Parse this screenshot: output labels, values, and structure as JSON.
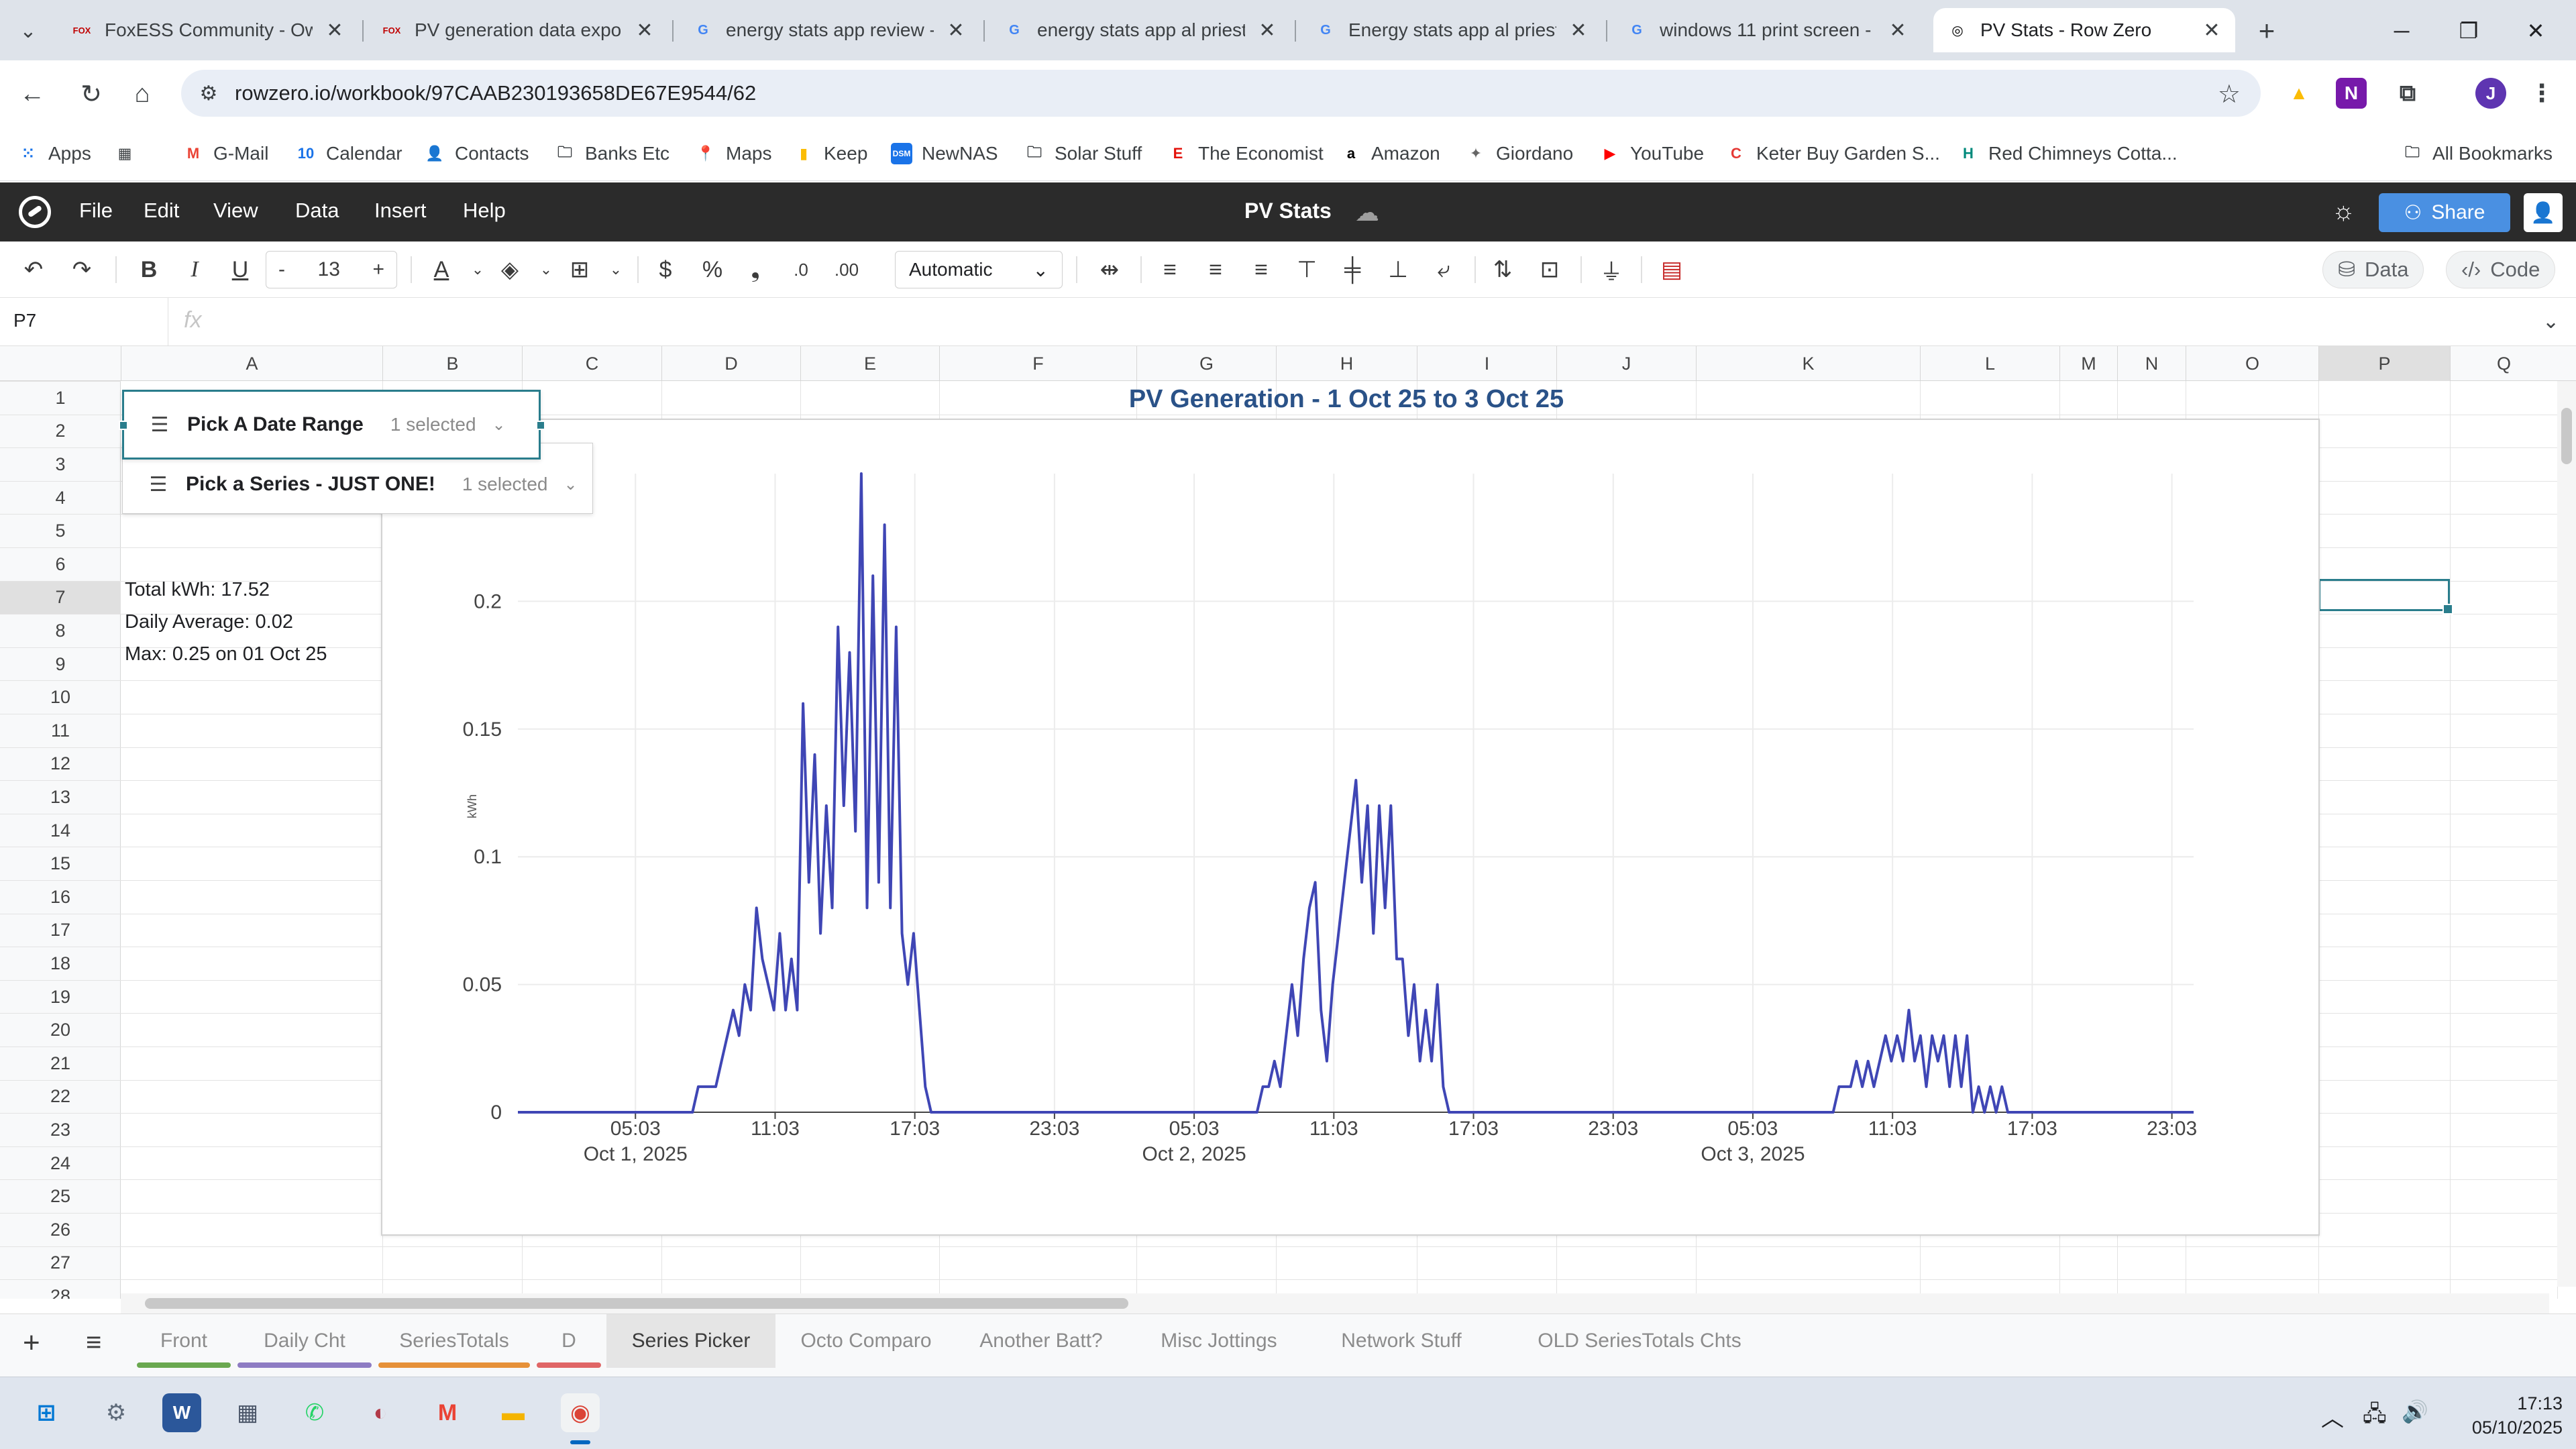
{
  "browser": {
    "tabs": [
      {
        "favicon": "FOX",
        "favicon_color": "#c00000",
        "title": "FoxESS Community - Ow",
        "active": false
      },
      {
        "favicon": "FOX",
        "favicon_color": "#c00000",
        "title": "PV generation data expor",
        "active": false
      },
      {
        "favicon": "G",
        "favicon_color": "#4285f4",
        "title": "energy stats app review -",
        "active": false
      },
      {
        "favicon": "G",
        "favicon_color": "#4285f4",
        "title": "energy stats app al priest",
        "active": false
      },
      {
        "favicon": "G",
        "favicon_color": "#4285f4",
        "title": "Energy stats app al priest",
        "active": false
      },
      {
        "favicon": "G",
        "favicon_color": "#4285f4",
        "title": "windows 11 print screen -",
        "active": false
      },
      {
        "favicon": "◎",
        "favicon_color": "#000000",
        "title": "PV Stats - Row Zero",
        "active": true
      }
    ],
    "url": "rowzero.io/workbook/97CAAB230193658DE67E9544/62",
    "bookmarks": [
      {
        "label": "Apps",
        "icon": "apps-grid-icon",
        "glyph": "⁙",
        "color": "#1a73e8"
      },
      {
        "label": "",
        "icon": "tab-groups-icon",
        "glyph": "▦",
        "color": "#3c4043"
      },
      {
        "label": "G-Mail",
        "icon": "gmail-icon",
        "glyph": "M",
        "color": "#ea4335"
      },
      {
        "label": "Calendar",
        "icon": "calendar-icon",
        "glyph": "10",
        "color": "#1a73e8"
      },
      {
        "label": "Contacts",
        "icon": "contacts-icon",
        "glyph": "👤",
        "color": "#1a73e8"
      },
      {
        "label": "Banks Etc",
        "icon": "folder-icon",
        "glyph": "🗀",
        "color": "#3c4043"
      },
      {
        "label": "Maps",
        "icon": "maps-icon",
        "glyph": "📍",
        "color": "#34a853"
      },
      {
        "label": "Keep",
        "icon": "keep-icon",
        "glyph": "▮",
        "color": "#fbbc04"
      },
      {
        "label": "NewNAS",
        "icon": "nas-icon",
        "glyph": "DSM",
        "color": "#1a73e8"
      },
      {
        "label": "Solar Stuff",
        "icon": "folder-icon",
        "glyph": "🗀",
        "color": "#3c4043"
      },
      {
        "label": "The Economist",
        "icon": "economist-icon",
        "glyph": "E",
        "color": "#e3120b"
      },
      {
        "label": "Amazon",
        "icon": "amazon-icon",
        "glyph": "a",
        "color": "#000000"
      },
      {
        "label": "Giordano",
        "icon": "giordano-icon",
        "glyph": "✦",
        "color": "#666666"
      },
      {
        "label": "YouTube",
        "icon": "youtube-icon",
        "glyph": "▶",
        "color": "#ff0000"
      },
      {
        "label": "Keter Buy Garden S...",
        "icon": "keter-icon",
        "glyph": "C",
        "color": "#e53935"
      },
      {
        "label": "Red Chimneys Cotta...",
        "icon": "red-chimneys-icon",
        "glyph": "H",
        "color": "#00897b"
      }
    ],
    "all_bookmarks": "All Bookmarks"
  },
  "app": {
    "menus": [
      "File",
      "Edit",
      "View",
      "Data",
      "Insert",
      "Help"
    ],
    "title": "PV Stats",
    "share_label": "Share",
    "font_size": "13",
    "number_format": "Automatic",
    "data_label": "Data",
    "code_label": "Code",
    "cell_ref": "P7",
    "fx": "fx"
  },
  "grid": {
    "columns": [
      "A",
      "B",
      "C",
      "D",
      "E",
      "F",
      "G",
      "H",
      "I",
      "J",
      "K",
      "L",
      "M",
      "N",
      "O",
      "P",
      "Q"
    ],
    "rows": [
      "1",
      "2",
      "3",
      "4",
      "5",
      "6",
      "7",
      "8",
      "9",
      "10",
      "11",
      "12",
      "13",
      "14",
      "15",
      "16",
      "17",
      "18",
      "19",
      "20",
      "21",
      "22",
      "23",
      "24",
      "25",
      "26",
      "27",
      "28"
    ],
    "selected_column": "P",
    "selected_row": "7",
    "cells": {
      "a7": "Total kWh: 17.52",
      "a8": "Daily Average: 0.02",
      "a9": "Max: 0.25 on 01 Oct 25"
    }
  },
  "slicers": {
    "date": {
      "title": "Pick A Date Range",
      "count": "1 selected"
    },
    "series": {
      "title": "Pick a Series - JUST ONE!",
      "count": "1 selected"
    }
  },
  "chart_data": {
    "type": "line",
    "title": "PV Generation - 1 Oct 25 to 3 Oct 25",
    "ylabel": "kWh",
    "xlabel": "",
    "ylim": [
      0,
      0.25
    ],
    "yticks": [
      "0",
      "0.05",
      "0.1",
      "0.15",
      "0.2"
    ],
    "xticks": [
      {
        "time": "05:03",
        "date": "Oct 1, 2025"
      },
      {
        "time": "11:03",
        "date": ""
      },
      {
        "time": "17:03",
        "date": ""
      },
      {
        "time": "23:03",
        "date": ""
      },
      {
        "time": "05:03",
        "date": "Oct 2, 2025"
      },
      {
        "time": "11:03",
        "date": ""
      },
      {
        "time": "17:03",
        "date": ""
      },
      {
        "time": "23:03",
        "date": ""
      },
      {
        "time": "05:03",
        "date": "Oct 3, 2025"
      },
      {
        "time": "11:03",
        "date": ""
      },
      {
        "time": "17:03",
        "date": ""
      },
      {
        "time": "23:03",
        "date": ""
      }
    ],
    "grid": true,
    "legend": "none",
    "line_color": "#3f46b5",
    "series": [
      {
        "points": [
          [
            "2025-10-01 00:00",
            0
          ],
          [
            "2025-10-01 07:30",
            0
          ],
          [
            "2025-10-01 07:45",
            0.01
          ],
          [
            "2025-10-01 08:30",
            0.01
          ],
          [
            "2025-10-01 08:45",
            0.02
          ],
          [
            "2025-10-01 09:00",
            0.03
          ],
          [
            "2025-10-01 09:15",
            0.04
          ],
          [
            "2025-10-01 09:30",
            0.03
          ],
          [
            "2025-10-01 09:45",
            0.05
          ],
          [
            "2025-10-01 10:00",
            0.04
          ],
          [
            "2025-10-01 10:15",
            0.08
          ],
          [
            "2025-10-01 10:30",
            0.06
          ],
          [
            "2025-10-01 10:45",
            0.05
          ],
          [
            "2025-10-01 11:00",
            0.04
          ],
          [
            "2025-10-01 11:15",
            0.07
          ],
          [
            "2025-10-01 11:30",
            0.04
          ],
          [
            "2025-10-01 11:45",
            0.06
          ],
          [
            "2025-10-01 12:00",
            0.04
          ],
          [
            "2025-10-01 12:15",
            0.16
          ],
          [
            "2025-10-01 12:30",
            0.09
          ],
          [
            "2025-10-01 12:45",
            0.14
          ],
          [
            "2025-10-01 13:00",
            0.07
          ],
          [
            "2025-10-01 13:15",
            0.12
          ],
          [
            "2025-10-01 13:30",
            0.08
          ],
          [
            "2025-10-01 13:45",
            0.19
          ],
          [
            "2025-10-01 14:00",
            0.12
          ],
          [
            "2025-10-01 14:15",
            0.18
          ],
          [
            "2025-10-01 14:30",
            0.11
          ],
          [
            "2025-10-01 14:45",
            0.25
          ],
          [
            "2025-10-01 15:00",
            0.08
          ],
          [
            "2025-10-01 15:15",
            0.21
          ],
          [
            "2025-10-01 15:30",
            0.09
          ],
          [
            "2025-10-01 15:45",
            0.23
          ],
          [
            "2025-10-01 16:00",
            0.08
          ],
          [
            "2025-10-01 16:15",
            0.19
          ],
          [
            "2025-10-01 16:30",
            0.07
          ],
          [
            "2025-10-01 16:45",
            0.05
          ],
          [
            "2025-10-01 17:00",
            0.07
          ],
          [
            "2025-10-01 17:15",
            0.04
          ],
          [
            "2025-10-01 17:30",
            0.01
          ],
          [
            "2025-10-01 17:45",
            0
          ],
          [
            "2025-10-02 07:45",
            0
          ],
          [
            "2025-10-02 08:00",
            0.01
          ],
          [
            "2025-10-02 08:15",
            0.01
          ],
          [
            "2025-10-02 08:30",
            0.02
          ],
          [
            "2025-10-02 08:45",
            0.01
          ],
          [
            "2025-10-02 09:00",
            0.03
          ],
          [
            "2025-10-02 09:15",
            0.05
          ],
          [
            "2025-10-02 09:30",
            0.03
          ],
          [
            "2025-10-02 09:45",
            0.06
          ],
          [
            "2025-10-02 10:00",
            0.08
          ],
          [
            "2025-10-02 10:15",
            0.09
          ],
          [
            "2025-10-02 10:30",
            0.04
          ],
          [
            "2025-10-02 10:45",
            0.02
          ],
          [
            "2025-10-02 11:00",
            0.05
          ],
          [
            "2025-10-02 11:15",
            0.07
          ],
          [
            "2025-10-02 11:30",
            0.09
          ],
          [
            "2025-10-02 11:45",
            0.11
          ],
          [
            "2025-10-02 12:00",
            0.13
          ],
          [
            "2025-10-02 12:15",
            0.09
          ],
          [
            "2025-10-02 12:30",
            0.12
          ],
          [
            "2025-10-02 12:45",
            0.07
          ],
          [
            "2025-10-02 13:00",
            0.12
          ],
          [
            "2025-10-02 13:15",
            0.08
          ],
          [
            "2025-10-02 13:30",
            0.12
          ],
          [
            "2025-10-02 13:45",
            0.06
          ],
          [
            "2025-10-02 14:00",
            0.06
          ],
          [
            "2025-10-02 14:15",
            0.03
          ],
          [
            "2025-10-02 14:30",
            0.05
          ],
          [
            "2025-10-02 14:45",
            0.02
          ],
          [
            "2025-10-02 15:00",
            0.04
          ],
          [
            "2025-10-02 15:15",
            0.02
          ],
          [
            "2025-10-02 15:30",
            0.05
          ],
          [
            "2025-10-02 15:45",
            0.01
          ],
          [
            "2025-10-02 16:00",
            0
          ],
          [
            "2025-10-03 08:30",
            0
          ],
          [
            "2025-10-03 08:45",
            0.01
          ],
          [
            "2025-10-03 09:15",
            0.01
          ],
          [
            "2025-10-03 09:30",
            0.02
          ],
          [
            "2025-10-03 09:45",
            0.01
          ],
          [
            "2025-10-03 10:00",
            0.02
          ],
          [
            "2025-10-03 10:15",
            0.01
          ],
          [
            "2025-10-03 10:30",
            0.02
          ],
          [
            "2025-10-03 10:45",
            0.03
          ],
          [
            "2025-10-03 11:00",
            0.02
          ],
          [
            "2025-10-03 11:15",
            0.03
          ],
          [
            "2025-10-03 11:30",
            0.02
          ],
          [
            "2025-10-03 11:45",
            0.04
          ],
          [
            "2025-10-03 12:00",
            0.02
          ],
          [
            "2025-10-03 12:15",
            0.03
          ],
          [
            "2025-10-03 12:30",
            0.01
          ],
          [
            "2025-10-03 12:45",
            0.03
          ],
          [
            "2025-10-03 13:00",
            0.02
          ],
          [
            "2025-10-03 13:15",
            0.03
          ],
          [
            "2025-10-03 13:30",
            0.01
          ],
          [
            "2025-10-03 13:45",
            0.03
          ],
          [
            "2025-10-03 14:00",
            0.01
          ],
          [
            "2025-10-03 14:15",
            0.03
          ],
          [
            "2025-10-03 14:30",
            0
          ],
          [
            "2025-10-03 14:45",
            0.01
          ],
          [
            "2025-10-03 15:00",
            0
          ],
          [
            "2025-10-03 15:15",
            0.01
          ],
          [
            "2025-10-03 15:30",
            0
          ],
          [
            "2025-10-03 15:45",
            0.01
          ],
          [
            "2025-10-03 16:00",
            0
          ],
          [
            "2025-10-03 23:59",
            0
          ]
        ]
      }
    ]
  },
  "sheets": [
    {
      "label": "Front",
      "color": "#6aa84f",
      "active": false
    },
    {
      "label": "Daily Cht",
      "color": "#8e7cc3",
      "active": false
    },
    {
      "label": "SeriesTotals",
      "color": "#e69138",
      "active": false
    },
    {
      "label": "D",
      "color": "#e06666",
      "active": false
    },
    {
      "label": "Series Picker",
      "color": "",
      "active": true
    },
    {
      "label": "Octo Comparo",
      "color": "",
      "active": false
    },
    {
      "label": "Another Batt?",
      "color": "",
      "active": false
    },
    {
      "label": "Misc Jottings",
      "color": "",
      "active": false
    },
    {
      "label": "Network Stuff",
      "color": "",
      "active": false
    },
    {
      "label": "OLD SeriesTotals Chts",
      "color": "",
      "active": false
    }
  ],
  "taskbar": {
    "apps": [
      {
        "name": "start-icon",
        "glyph": "⊞",
        "color": "#0078d4"
      },
      {
        "name": "settings-icon",
        "glyph": "⚙",
        "color": "#5f6b7a"
      },
      {
        "name": "word-app-icon",
        "glyph": "W",
        "color": "#2b579a"
      },
      {
        "name": "calculator-icon",
        "glyph": "▦",
        "color": "#4a5568"
      },
      {
        "name": "whatsapp-icon",
        "glyph": "✆",
        "color": "#25d366"
      },
      {
        "name": "recorder-icon",
        "glyph": "◐",
        "color": "#b23a48"
      },
      {
        "name": "gmail-app-icon",
        "glyph": "M",
        "color": "#ea4335"
      },
      {
        "name": "file-explorer-icon",
        "glyph": "▬",
        "color": "#f4b400"
      },
      {
        "name": "chrome-icon",
        "glyph": "◉",
        "color": "#db4437"
      }
    ],
    "time": "17:13",
    "date": "05/10/2025"
  }
}
